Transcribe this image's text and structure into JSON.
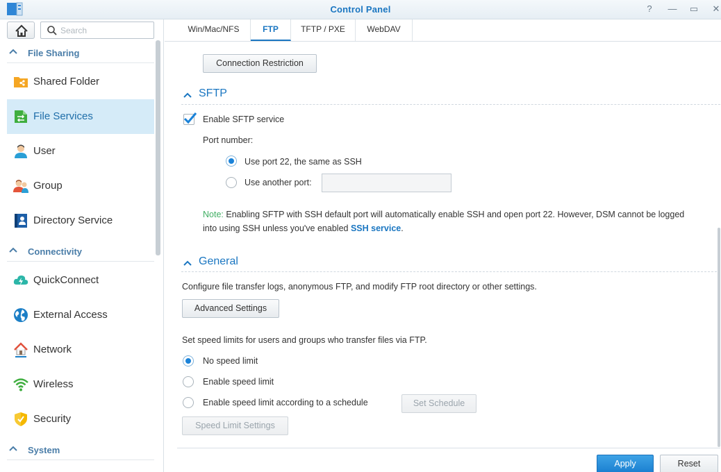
{
  "window": {
    "title": "Control Panel",
    "controls": {
      "help": "?",
      "minimize": "—",
      "maximize": "▭",
      "close": "✕"
    }
  },
  "sidebar": {
    "search_placeholder": "Search",
    "sections": [
      {
        "label": "File Sharing",
        "items": [
          {
            "label": "Shared Folder",
            "icon": "shared-folder-icon",
            "active": false
          },
          {
            "label": "File Services",
            "icon": "file-services-icon",
            "active": true
          },
          {
            "label": "User",
            "icon": "user-icon",
            "active": false
          },
          {
            "label": "Group",
            "icon": "group-icon",
            "active": false
          },
          {
            "label": "Directory Service",
            "icon": "directory-service-icon",
            "active": false
          }
        ]
      },
      {
        "label": "Connectivity",
        "items": [
          {
            "label": "QuickConnect",
            "icon": "quickconnect-icon",
            "active": false
          },
          {
            "label": "External Access",
            "icon": "globe-icon",
            "active": false
          },
          {
            "label": "Network",
            "icon": "network-icon",
            "active": false
          },
          {
            "label": "Wireless",
            "icon": "wifi-icon",
            "active": false
          },
          {
            "label": "Security",
            "icon": "shield-icon",
            "active": false
          }
        ]
      },
      {
        "label": "System",
        "items": []
      }
    ]
  },
  "tabs": [
    {
      "label": "Win/Mac/NFS",
      "active": false
    },
    {
      "label": "FTP",
      "active": true
    },
    {
      "label": "TFTP / PXE",
      "active": false
    },
    {
      "label": "WebDAV",
      "active": false
    }
  ],
  "content": {
    "connection_restriction_label": "Connection Restriction",
    "sftp": {
      "title": "SFTP",
      "enable_label": "Enable SFTP service",
      "enable_checked": true,
      "port_number_label": "Port number:",
      "port_option_default": "Use port 22, the same as SSH",
      "port_option_other": "Use another port:",
      "other_port_value": "",
      "note_prefix": "Note:",
      "note_line1": " Enabling SFTP with SSH default port will automatically enable SSH and open port 22. However, DSM cannot be logged",
      "note_line2_a": "into using SSH unless you've enabled ",
      "note_link": "SSH service",
      "note_line2_b": "."
    },
    "general": {
      "title": "General",
      "description": "Configure file transfer logs, anonymous FTP, and modify FTP root directory or other settings.",
      "advanced_settings_label": "Advanced Settings",
      "speed_description": "Set speed limits for users and groups who transfer files via FTP.",
      "speed_options": [
        {
          "label": "No speed limit",
          "selected": true
        },
        {
          "label": "Enable speed limit",
          "selected": false
        },
        {
          "label": "Enable speed limit according to a schedule",
          "selected": false
        }
      ],
      "set_schedule_label": "Set Schedule",
      "speed_limit_settings_label": "Speed Limit Settings"
    }
  },
  "footer": {
    "apply_label": "Apply",
    "reset_label": "Reset"
  },
  "colors": {
    "accent": "#1a76c1",
    "active_nav_bg": "#d5ebf8",
    "note_green": "#3fae62"
  }
}
